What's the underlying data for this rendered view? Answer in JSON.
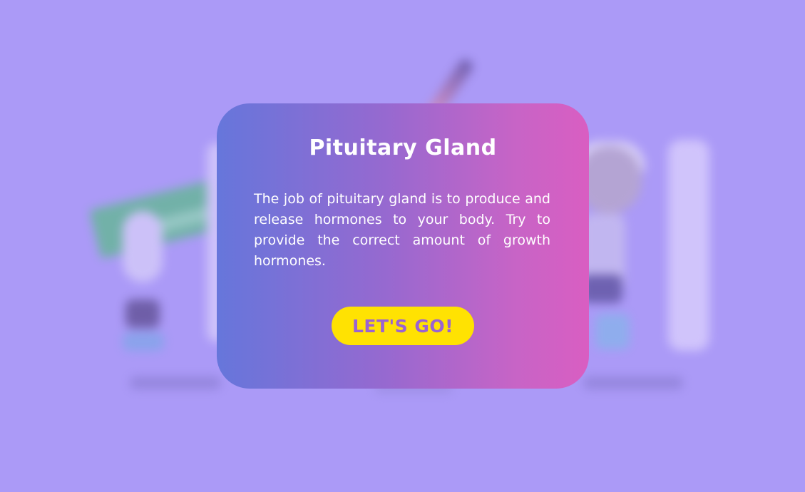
{
  "modal": {
    "title": "Pituitary Gland",
    "body": "The job of pituitary gland is to produce and release hormones to your body. Try to provide the correct amount of growth hormones.",
    "button_label": "LET'S GO!"
  },
  "colors": {
    "background": "#ab9af7",
    "modal_gradient_start": "#6676db",
    "modal_gradient_end": "#d95ec2",
    "button_background": "#ffe202",
    "button_text": "#9a63d2",
    "text": "#ffffff"
  }
}
